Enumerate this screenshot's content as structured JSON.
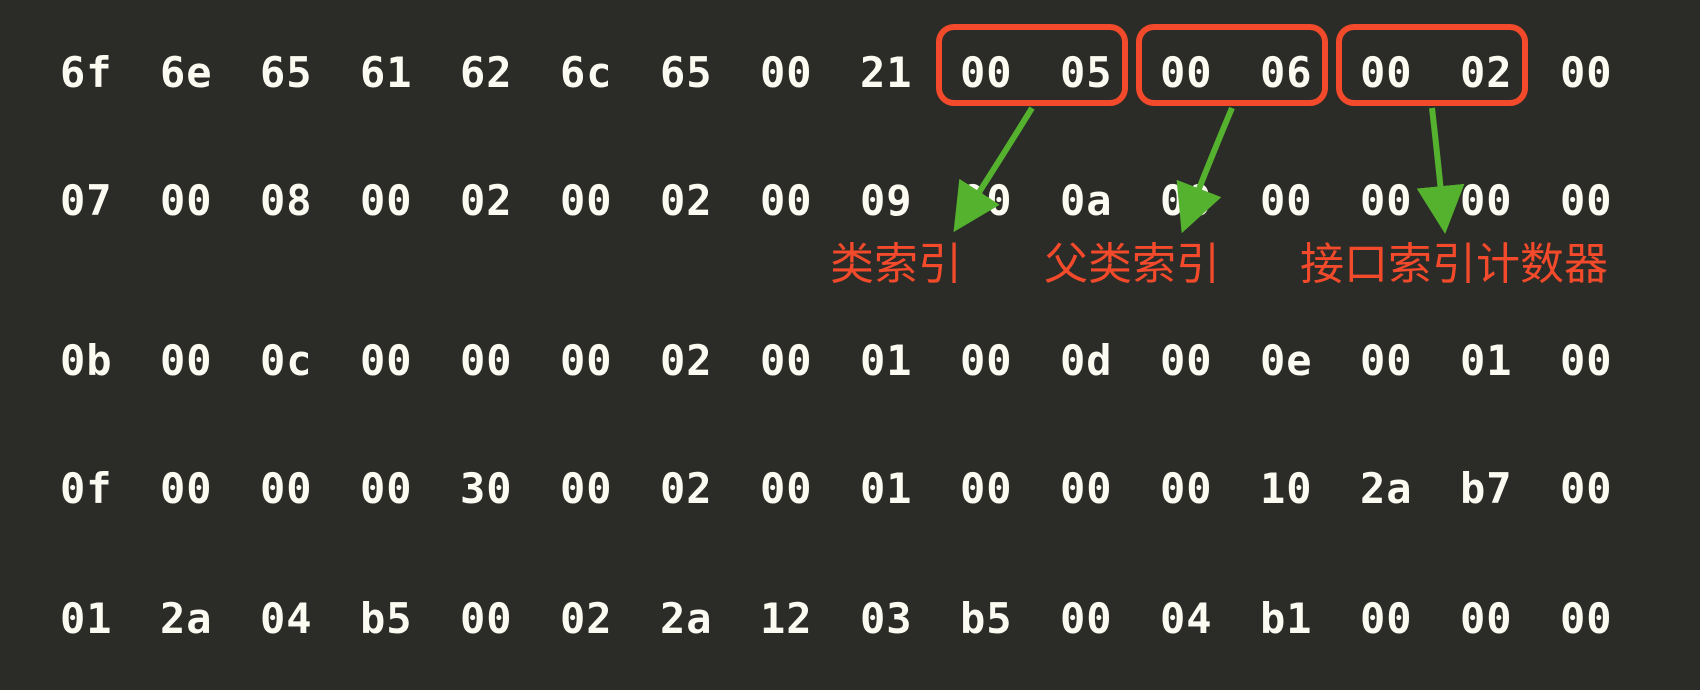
{
  "hex": {
    "row0": [
      "6f",
      "6e",
      "65",
      "61",
      "62",
      "6c",
      "65",
      "00",
      "21",
      "00",
      "05",
      "00",
      "06",
      "00",
      "02",
      "00"
    ],
    "row1": [
      "07",
      "00",
      "08",
      "00",
      "02",
      "00",
      "02",
      "00",
      "09",
      "00",
      "0a",
      "00",
      "00",
      "00",
      "00",
      "00"
    ],
    "row2": [
      "0b",
      "00",
      "0c",
      "00",
      "00",
      "00",
      "02",
      "00",
      "01",
      "00",
      "0d",
      "00",
      "0e",
      "00",
      "01",
      "00"
    ],
    "row3": [
      "0f",
      "00",
      "00",
      "00",
      "30",
      "00",
      "02",
      "00",
      "01",
      "00",
      "00",
      "00",
      "10",
      "2a",
      "b7",
      "00"
    ],
    "row4": [
      "01",
      "2a",
      "04",
      "b5",
      "00",
      "02",
      "2a",
      "12",
      "03",
      "b5",
      "00",
      "04",
      "b1",
      "00",
      "00",
      "00"
    ]
  },
  "annotations": {
    "class_index": "类索引",
    "super_class_index": "父类索引",
    "interfaces_count": "接口索引计数器"
  },
  "callouts": {
    "class_index": {
      "cols": [
        9,
        10
      ]
    },
    "super_class_index": {
      "cols": [
        11,
        12
      ]
    },
    "interfaces_count": {
      "cols": [
        13,
        14
      ]
    }
  },
  "colors": {
    "background": "#2b2b28",
    "hex_text": "#fbfbf2",
    "highlight_border": "#f24a2a",
    "annotation_text": "#f24a2a",
    "arrow": "#55b22e"
  }
}
